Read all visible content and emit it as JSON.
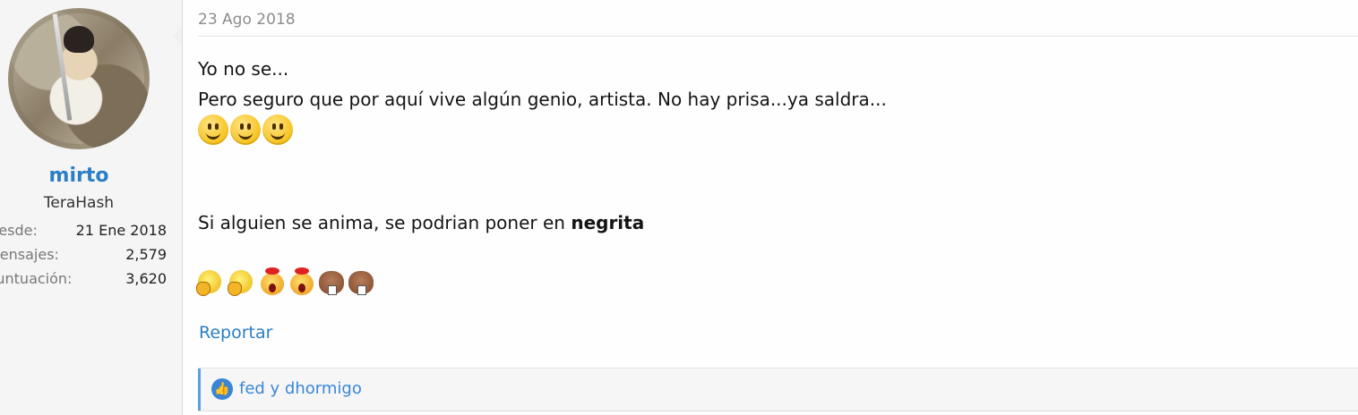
{
  "author": {
    "name": "mirto",
    "title": "TeraHash",
    "stats": [
      {
        "label": "Desde:",
        "value": "21 Ene 2018"
      },
      {
        "label": "Mensajes:",
        "value": "2,579"
      },
      {
        "label": "Puntuación:",
        "value": "3,620"
      }
    ]
  },
  "post": {
    "date": "23 Ago 2018",
    "line1": "Yo no se...",
    "line2": "Pero seguro que por aquí vive algún genio, artista. No hay prisa...ya saldra...",
    "smileys": [
      "smile-icon",
      "smile-icon",
      "smile-icon"
    ],
    "line3_prefix": "Si alguien se anima, se podrian poner en ",
    "line3_bold": "negrita",
    "emoticons": [
      "thinking-icon",
      "thinking-icon",
      "shocked-icon",
      "shocked-icon",
      "beaver-icon",
      "beaver-icon"
    ]
  },
  "actions": {
    "report_label": "Reportar"
  },
  "likes": {
    "text": "fed y dhormigo",
    "icon": "thumbs-up-icon",
    "accent": "#3a86d6"
  }
}
